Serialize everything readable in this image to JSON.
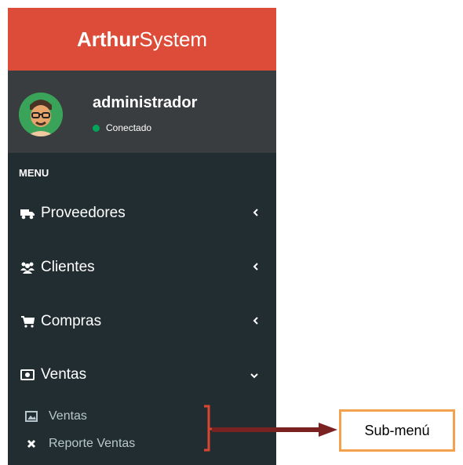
{
  "brand": {
    "bold": "Arthur",
    "rest": "System"
  },
  "user": {
    "name": "administrador",
    "status": "Conectado"
  },
  "menu": {
    "header": "MENU",
    "items": [
      {
        "label": "Proveedores",
        "icon": "truck-icon",
        "chevron": "chevron-left-icon"
      },
      {
        "label": "Clientes",
        "icon": "users-icon",
        "chevron": "chevron-left-icon"
      },
      {
        "label": "Compras",
        "icon": "shopping-cart-icon",
        "chevron": "chevron-left-icon"
      },
      {
        "label": "Ventas",
        "icon": "money-icon",
        "chevron": "chevron-down-icon"
      }
    ],
    "submenu": [
      {
        "label": "Ventas",
        "icon": "image-icon"
      },
      {
        "label": "Reporte Ventas",
        "icon": "times-icon"
      }
    ]
  },
  "callout": {
    "label": "Sub-menú"
  },
  "colors": {
    "brand_bg": "#dd4b39",
    "sidebar_bg": "#222d32",
    "user_panel_bg": "#3a3d3f",
    "status_dot": "#00a65a",
    "callout_border": "#f3a14c",
    "arrow": "#7a2222"
  }
}
